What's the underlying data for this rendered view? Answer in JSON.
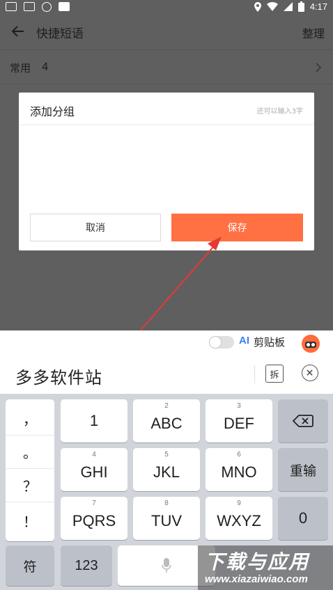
{
  "status_bar": {
    "time": "4:17"
  },
  "app_bar": {
    "title": "快捷短语",
    "action_label": "整理"
  },
  "group_row": {
    "name": "常用",
    "count": "4"
  },
  "dialog": {
    "title": "添加分组",
    "hint": "还可以输入3字",
    "input_value": "",
    "cancel_label": "取消",
    "save_label": "保存"
  },
  "keyboard_toolbar": {
    "ai_label": "AI",
    "clipboard_label": "剪贴板"
  },
  "candidate_bar": {
    "composition": "多多软件站",
    "split_label": "拆"
  },
  "keyboard": {
    "punctuation": [
      "，",
      "。",
      "？",
      "！"
    ],
    "keys": [
      {
        "num": "",
        "label": "1"
      },
      {
        "num": "2",
        "label": "ABC"
      },
      {
        "num": "3",
        "label": "DEF"
      },
      {
        "num": "4",
        "label": "GHI"
      },
      {
        "num": "5",
        "label": "JKL"
      },
      {
        "num": "6",
        "label": "MNO"
      },
      {
        "num": "7",
        "label": "PQRS"
      },
      {
        "num": "8",
        "label": "TUV"
      },
      {
        "num": "9",
        "label": "WXYZ"
      }
    ],
    "reinput_label": "重输",
    "zero_label": "0",
    "symbol_label": "符",
    "number_label": "123"
  },
  "watermark": {
    "title": "下载与应用",
    "url": "www.xiazaiwiao.com"
  },
  "colors": {
    "accent": "#ff7043",
    "overlay": "#5f5f5f",
    "ai_blue": "#3b82f6"
  }
}
